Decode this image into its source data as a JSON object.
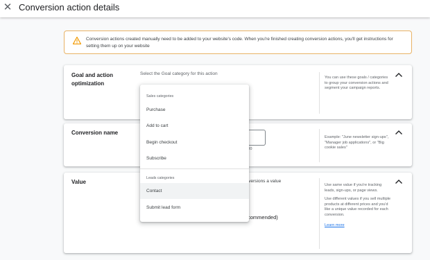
{
  "header": {
    "close_icon": "close-icon",
    "title": "Conversion action details"
  },
  "alert": {
    "icon": "warning-icon",
    "color": "#f29900",
    "text": "Conversion actions created manually need to be added to your website's code. When you're finished creating conversion actions, you'll get instructions for setting them up on your website"
  },
  "goal_card": {
    "title": "Goal and action optimization",
    "prompt": "Select the Goal category for this action",
    "help": "You can use these goals / categories to group your conversion actions and segment your campaign reports."
  },
  "name_card": {
    "title": "Conversion name",
    "char_count": "/ 100",
    "help": "Example: \"June newsletter sign-ups\", \"Manager job applications\", or \"Big cookie sales\""
  },
  "value_card": {
    "title": "Value",
    "desc": "onversions a value",
    "option_note": "ot recommended)",
    "help_1": "Use same value if you're tracking leads, sign-ups, or page views.",
    "help_2": "Use different values if you sell multiple products at different prices and you'd like a unique value recorded for each conversion.",
    "learn_more": "Learn more"
  },
  "dropdown": {
    "sales_header": "Sales categories",
    "sales_items": [
      "Purchase",
      "Add to cart",
      "Begin checkout",
      "Subscribe"
    ],
    "leads_header": "Leads categories",
    "leads_items": [
      "Contact",
      "Submit lead form"
    ],
    "highlighted": "Contact"
  },
  "colors": {
    "link": "#1a73e8",
    "alert_border": "#e8b264",
    "highlight": "#f1f3f4"
  }
}
